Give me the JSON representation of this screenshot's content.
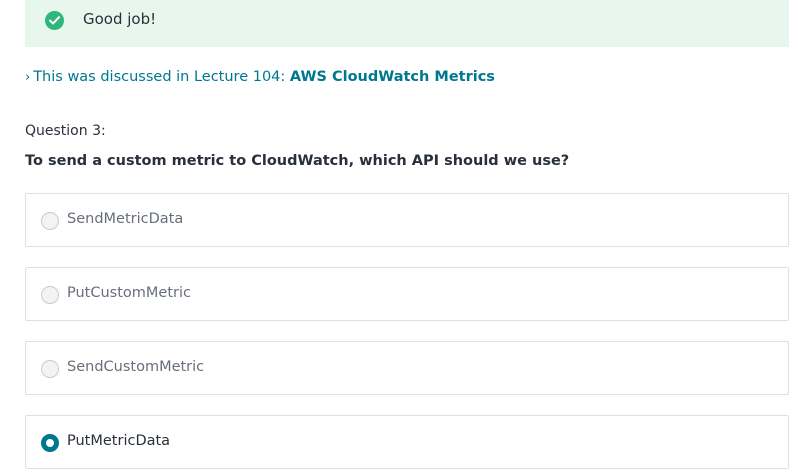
{
  "feedback": {
    "icon": "check-circle-icon",
    "message": "Good job!",
    "accent": "#2eb67d",
    "background": "#e8f7ee"
  },
  "reference": {
    "chevron": "›",
    "prefix": "This was discussed in Lecture 104: ",
    "lecture_title": "AWS CloudWatch Metrics",
    "color": "#007791"
  },
  "question": {
    "number_label": "Question 3:",
    "text": "To send a custom metric to CloudWatch, which API should we use?"
  },
  "options": [
    {
      "label": "SendMetricData",
      "selected": false
    },
    {
      "label": "PutCustomMetric",
      "selected": false
    },
    {
      "label": "SendCustomMetric",
      "selected": false
    },
    {
      "label": "PutMetricData",
      "selected": true
    }
  ]
}
